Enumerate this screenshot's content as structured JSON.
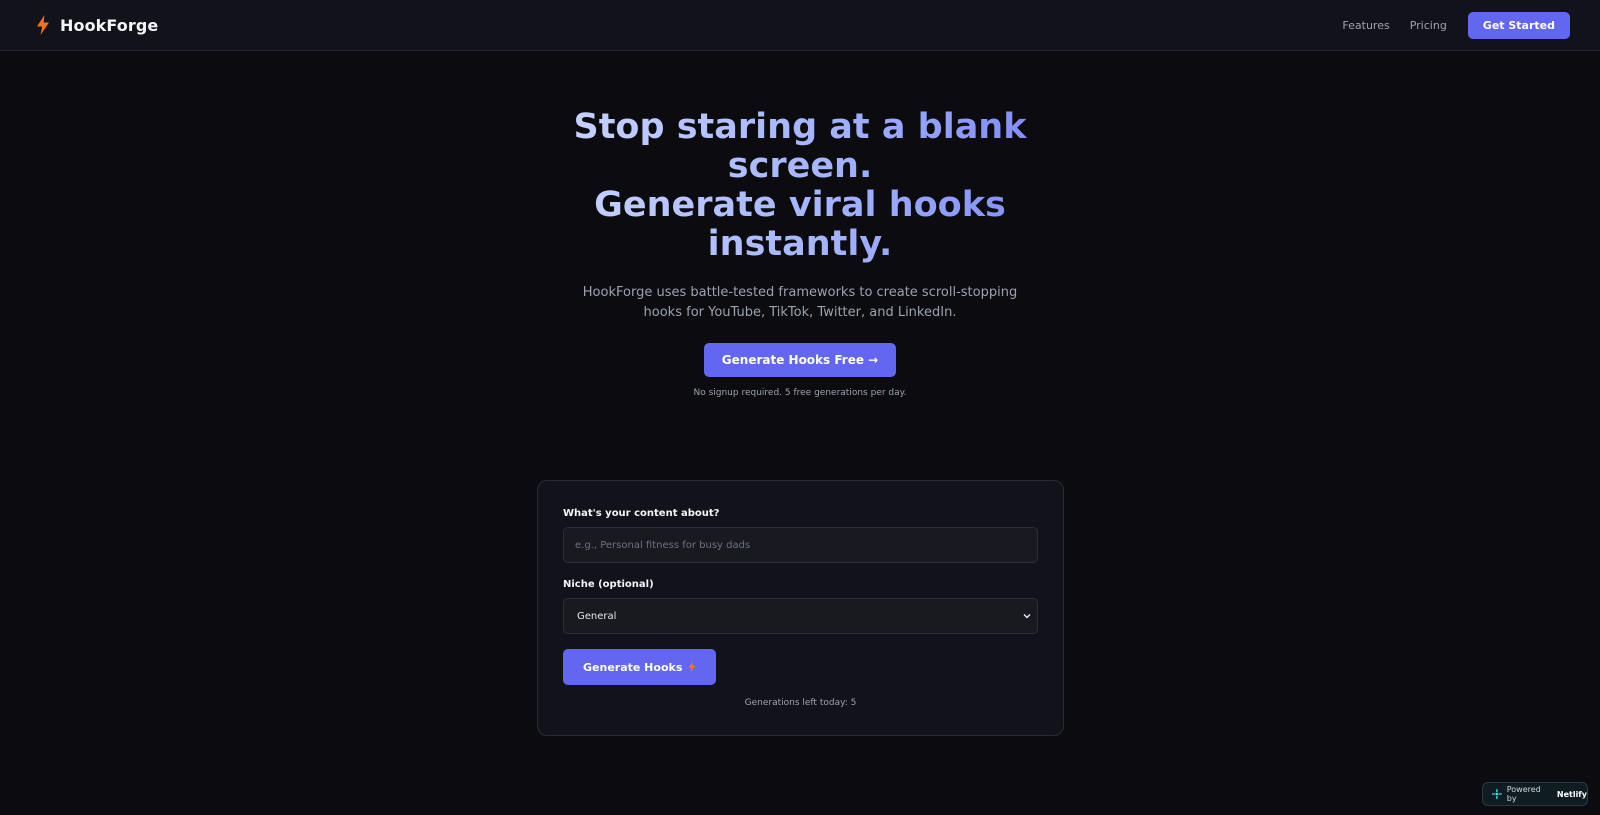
{
  "nav": {
    "brand": "HookForge",
    "logo_icon": "bolt-icon",
    "links": [
      "Features",
      "Pricing"
    ],
    "cta_label": "Get Started"
  },
  "hero": {
    "title_lines": [
      "Stop staring at a blank",
      "screen.",
      "Generate viral hooks",
      "instantly."
    ],
    "subtitle": "HookForge uses battle-tested frameworks to create scroll-stopping hooks for YouTube, TikTok, Twitter, and LinkedIn.",
    "cta_label": "Generate Hooks Free →",
    "note": "No signup required. 5 free generations per day."
  },
  "form": {
    "content_label": "What's your content about?",
    "content_placeholder": "e.g., Personal fitness for busy dads",
    "content_value": "",
    "niche_label": "Niche (optional)",
    "niche_selected": "General",
    "generate_label": "Generate Hooks",
    "generate_icon": "bolt-icon",
    "generations_left": "Generations left today: 5"
  },
  "badge": {
    "prefix": "Powered by",
    "brand": "Netlify",
    "icon": "netlify-icon"
  },
  "colors": {
    "background": "#0b0b10",
    "navbar": "#12121a",
    "accent": "#6366f1",
    "logo_orange": "#f97316",
    "title_gradient": [
      "#c7d2fe",
      "#a5b4fc",
      "#818cf8"
    ],
    "muted_text": "#9ca3af"
  }
}
